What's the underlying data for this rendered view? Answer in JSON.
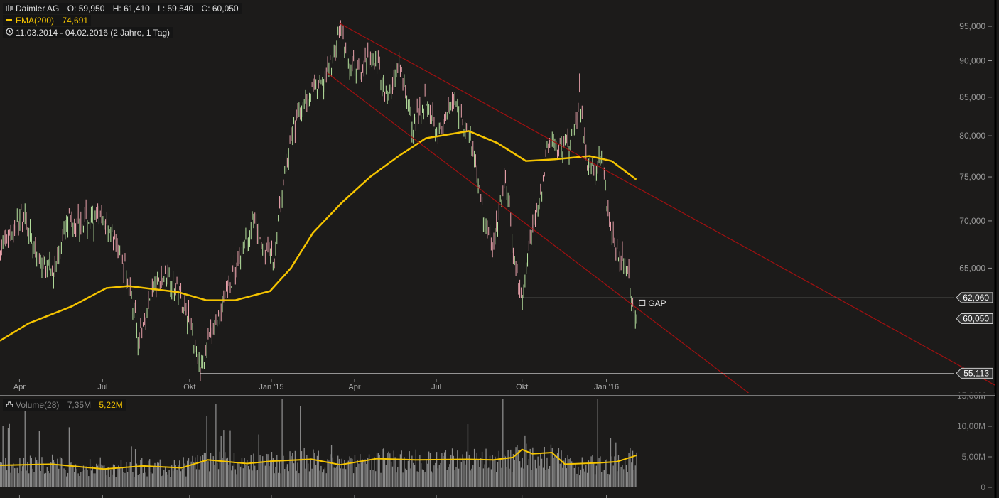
{
  "header": {
    "instrument": "Daimler AG",
    "open": "O: 59,950",
    "high": "H: 61,410",
    "low": "L: 59,540",
    "close": "C: 60,050",
    "ema_label": "EMA(200)",
    "ema_value": "74,691",
    "range": "11.03.2014 - 04.02.2016 (2 Jahre, 1 Tag)",
    "volume_label": "Volume(28)",
    "volume_value": "7,35M",
    "volume_avg": "5,22M"
  },
  "colors": {
    "background": "#1c1b1a",
    "ema": "#f5c400",
    "trend": "#a01010",
    "up": "#b8e4a0",
    "down": "#eaa2ac",
    "volume": "#8a8a8a"
  },
  "chart_data": {
    "type": "candlestick",
    "title": "Daimler AG",
    "scale": "log",
    "ylim": [
      52000,
      98000
    ],
    "price_ticks": [
      "95,000",
      "90,000",
      "85,000",
      "80,000",
      "75,000",
      "70,000",
      "65,000"
    ],
    "price_tick_values": [
      95000,
      90000,
      85000,
      80000,
      75000,
      70000,
      65000
    ],
    "x_ticks": [
      {
        "label": "Apr",
        "day": 15
      },
      {
        "label": "Jul",
        "day": 79
      },
      {
        "label": "Okt",
        "day": 146
      },
      {
        "label": "Jan '15",
        "day": 209
      },
      {
        "label": "Apr",
        "day": 273
      },
      {
        "label": "Jul",
        "day": 336
      },
      {
        "label": "Okt",
        "day": 402
      },
      {
        "label": "Jan '16",
        "day": 467
      }
    ],
    "x_range_days": [
      0,
      766
    ],
    "price_path": [
      [
        0,
        67
      ],
      [
        19,
        71
      ],
      [
        27,
        66
      ],
      [
        41,
        64.5
      ],
      [
        52,
        70
      ],
      [
        71,
        70
      ],
      [
        82,
        70
      ],
      [
        96,
        65
      ],
      [
        107,
        58
      ],
      [
        118,
        63
      ],
      [
        129,
        64.5
      ],
      [
        140,
        62
      ],
      [
        148,
        59
      ],
      [
        154,
        55.5
      ],
      [
        164,
        59
      ],
      [
        175,
        63
      ],
      [
        186,
        66.5
      ],
      [
        194,
        70
      ],
      [
        203,
        67
      ],
      [
        211,
        66
      ],
      [
        216,
        72
      ],
      [
        224,
        80
      ],
      [
        235,
        85
      ],
      [
        249,
        87
      ],
      [
        257,
        91
      ],
      [
        262,
        95
      ],
      [
        268,
        89
      ],
      [
        279,
        89
      ],
      [
        290,
        90
      ],
      [
        298,
        85
      ],
      [
        307,
        89
      ],
      [
        318,
        81
      ],
      [
        328,
        85
      ],
      [
        339,
        80
      ],
      [
        350,
        85
      ],
      [
        361,
        80
      ],
      [
        366,
        77
      ],
      [
        372,
        70
      ],
      [
        380,
        67
      ],
      [
        389,
        75
      ],
      [
        397,
        64
      ],
      [
        402,
        62
      ],
      [
        408,
        68
      ],
      [
        416,
        73
      ],
      [
        422,
        79
      ],
      [
        433,
        78
      ],
      [
        441,
        80
      ],
      [
        446,
        85
      ],
      [
        452,
        77
      ],
      [
        457,
        76
      ],
      [
        463,
        78
      ],
      [
        468,
        71
      ],
      [
        474,
        67
      ],
      [
        482,
        65
      ],
      [
        490,
        60.05
      ]
    ],
    "ema200": [
      [
        0,
        58.0
      ],
      [
        22,
        59.6
      ],
      [
        55,
        61.2
      ],
      [
        82,
        63.0
      ],
      [
        99,
        63.2
      ],
      [
        137,
        62.6
      ],
      [
        159,
        61.8
      ],
      [
        181,
        61.8
      ],
      [
        208,
        62.7
      ],
      [
        224,
        65.0
      ],
      [
        241,
        68.7
      ],
      [
        263,
        72.0
      ],
      [
        285,
        75.0
      ],
      [
        307,
        77.5
      ],
      [
        328,
        79.7
      ],
      [
        361,
        80.6
      ],
      [
        383,
        79.1
      ],
      [
        405,
        76.9
      ],
      [
        427,
        77.1
      ],
      [
        454,
        77.5
      ],
      [
        471,
        76.9
      ],
      [
        490,
        74.691
      ]
    ],
    "trendlines": [
      {
        "name": "upper channel",
        "from": [
          261,
          95.5
        ],
        "to": [
          766,
          54.1
        ]
      },
      {
        "name": "lower channel",
        "from": [
          252,
          88.3
        ],
        "to": [
          578,
          53.3
        ]
      }
    ],
    "levels": [
      {
        "value": 62060,
        "label": "62,060",
        "from_day": 401
      },
      {
        "value": 60050,
        "label": "60,050",
        "from_day": null
      },
      {
        "value": 55113,
        "label": "55,113",
        "from_day": 154
      }
    ],
    "annotation": {
      "label": "GAP",
      "day": 492,
      "price": 61.0
    },
    "volume": {
      "ylim": [
        0,
        15
      ],
      "ticks": [
        "15,00M",
        "10,00M",
        "5,00M",
        "0"
      ],
      "tick_values": [
        15,
        10,
        5,
        0
      ],
      "avg_path": [
        [
          0,
          3.6
        ],
        [
          40,
          3.8
        ],
        [
          80,
          3.0
        ],
        [
          110,
          3.5
        ],
        [
          140,
          3.2
        ],
        [
          160,
          4.5
        ],
        [
          190,
          3.9
        ],
        [
          210,
          4.3
        ],
        [
          240,
          4.6
        ],
        [
          262,
          3.7
        ],
        [
          290,
          4.7
        ],
        [
          320,
          4.5
        ],
        [
          360,
          4.6
        ],
        [
          380,
          4.5
        ],
        [
          395,
          4.9
        ],
        [
          402,
          6.2
        ],
        [
          410,
          5.5
        ],
        [
          425,
          5.7
        ],
        [
          435,
          3.8
        ],
        [
          460,
          4.0
        ],
        [
          475,
          4.2
        ],
        [
          490,
          5.22
        ]
      ]
    }
  }
}
